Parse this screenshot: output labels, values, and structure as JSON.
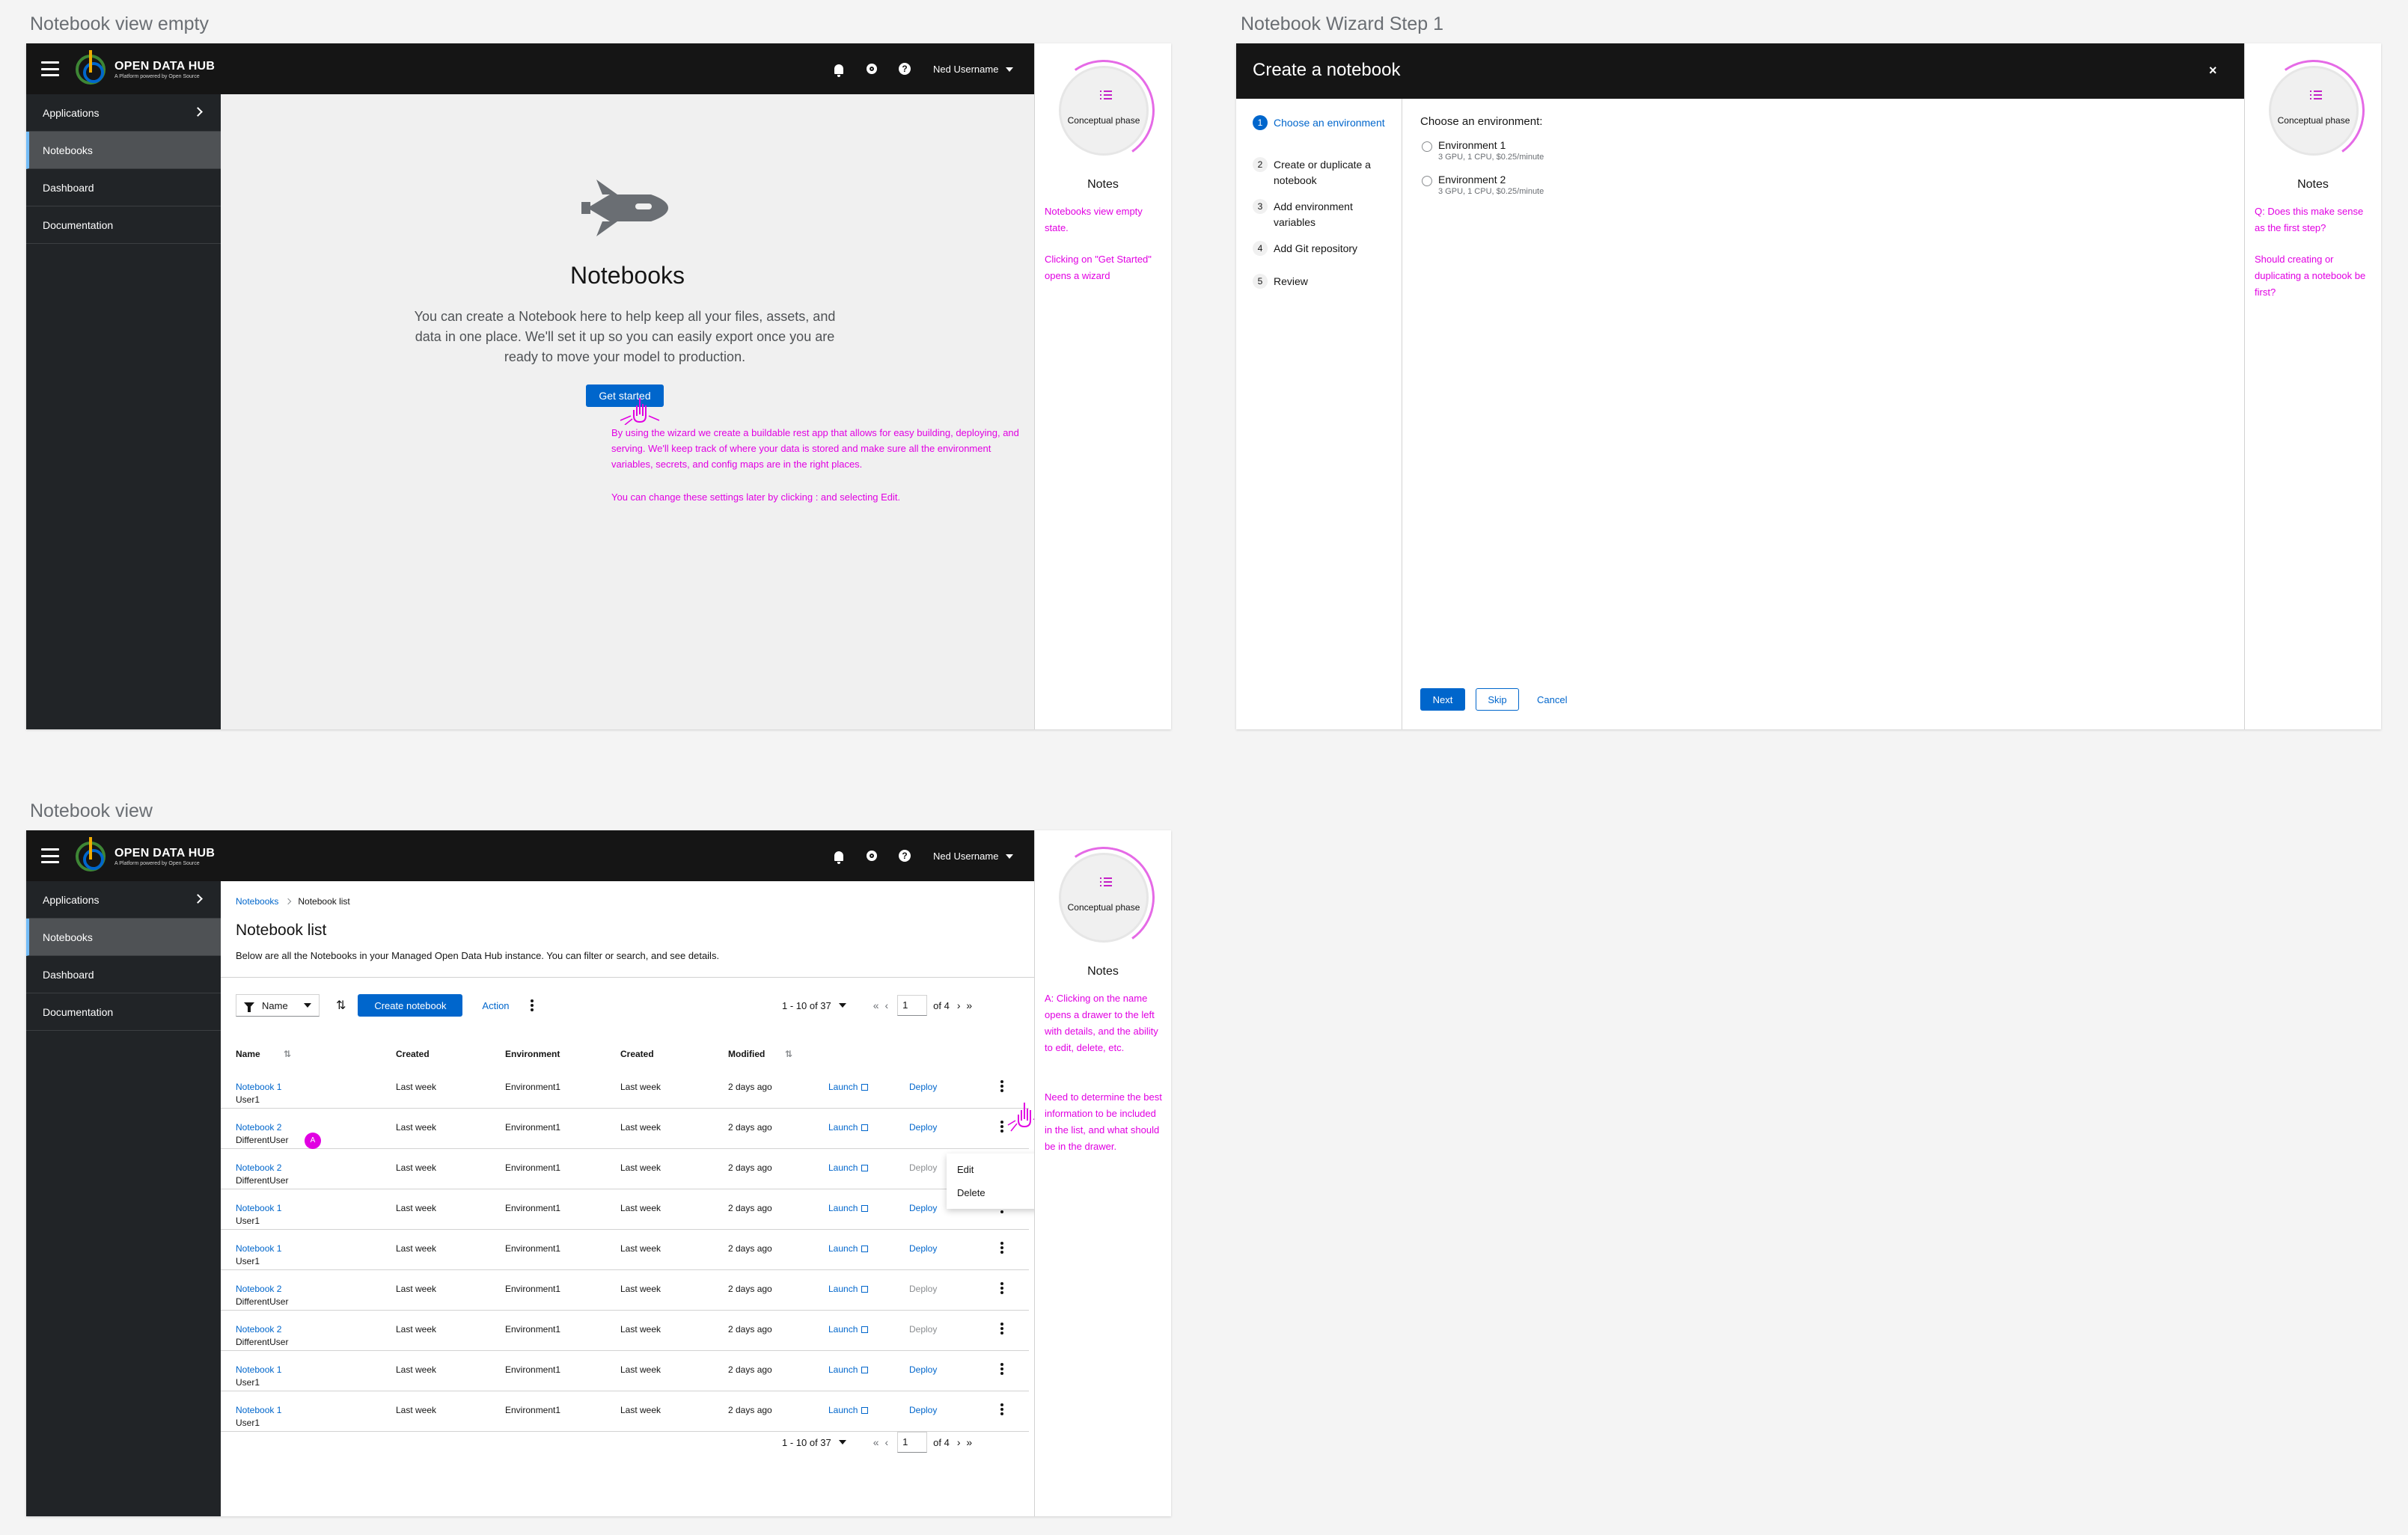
{
  "frames": {
    "empty_title": "Notebook view empty",
    "wizard_title": "Notebook Wizard Step 1",
    "list_title": "Notebook view"
  },
  "masthead": {
    "brand": "OPEN DATA HUB",
    "brand_sub": "A Platform powered by Open Source",
    "user": "Ned Username"
  },
  "sidebar": {
    "items": [
      "Applications",
      "Notebooks",
      "Dashboard",
      "Documentation"
    ]
  },
  "notes": {
    "phase": "Conceptual phase",
    "title": "Notes",
    "empty": [
      "Notebooks view empty state.",
      "Clicking on \"Get Started\" opens a wizard"
    ],
    "wizard": [
      "Q: Does this make sense as the first step?",
      "Should creating or duplicating a notebook be first?"
    ],
    "list": [
      "A: Clicking on the name opens a drawer to the left with details, and the ability to edit, delete, etc.",
      "Need to determine the best information to be included in the list, and what should be in the drawer."
    ]
  },
  "empty_state": {
    "title": "Notebooks",
    "body": "You can create a Notebook here to help keep all your files, assets, and data in one place. We'll set it up so you can easily export once you are ready to move your model to production.",
    "button": "Get started",
    "annotation1": "By using the wizard we create a buildable rest app that allows for easy building, deploying, and serving. We'll keep track of where your data is stored and make sure all the environment variables, secrets, and config maps are in the right places.",
    "annotation2": "You can change these settings later by clicking : and selecting Edit."
  },
  "wizard": {
    "title": "Create a notebook",
    "close": "×",
    "steps": [
      {
        "num": "1",
        "label": "Choose an environment"
      },
      {
        "num": "2",
        "label": "Create or duplicate a notebook"
      },
      {
        "num": "3",
        "label": "Add environment variables"
      },
      {
        "num": "4",
        "label": "Add Git repository"
      },
      {
        "num": "5",
        "label": "Review"
      }
    ],
    "prompt": "Choose an environment:",
    "options": [
      {
        "label": "Environment 1",
        "desc": "3 GPU, 1 CPU, $0.25/minute"
      },
      {
        "label": "Environment 2",
        "desc": "3 GPU, 1 CPU, $0.25/minute"
      }
    ],
    "next": "Next",
    "skip": "Skip",
    "cancel": "Cancel"
  },
  "list": {
    "breadcrumb": [
      "Notebooks",
      "Notebook list"
    ],
    "title": "Notebook list",
    "description": "Below are all the Notebooks in your Managed Open Data Hub instance. You can filter or search, and see details.",
    "filter": "Name",
    "create_button": "Create notebook",
    "action_button": "Action",
    "pagination": {
      "range": "1 - 10 of 37",
      "page": "1",
      "of": "of 4"
    },
    "columns": [
      "Name",
      "Created",
      "Environment",
      "Created",
      "Modified"
    ],
    "rows": [
      {
        "name": "Notebook 1",
        "user": "User1",
        "created": "Last week",
        "env": "Environment1",
        "created2": "Last week",
        "modified": "2 days ago",
        "launch": "Launch",
        "deploy": "Deploy",
        "deploy_enabled": true
      },
      {
        "name": "Notebook 2",
        "user": "DifferentUser",
        "created": "Last week",
        "env": "Environment1",
        "created2": "Last week",
        "modified": "2 days ago",
        "launch": "Launch",
        "deploy": "Deploy",
        "deploy_enabled": true
      },
      {
        "name": "Notebook 2",
        "user": "DifferentUser",
        "created": "Last week",
        "env": "Environment1",
        "created2": "Last week",
        "modified": "2 days ago",
        "launch": "Launch",
        "deploy": "Deploy",
        "deploy_enabled": false
      },
      {
        "name": "Notebook 1",
        "user": "User1",
        "created": "Last week",
        "env": "Environment1",
        "created2": "Last week",
        "modified": "2 days ago",
        "launch": "Launch",
        "deploy": "Deploy",
        "deploy_enabled": true
      },
      {
        "name": "Notebook 1",
        "user": "User1",
        "created": "Last week",
        "env": "Environment1",
        "created2": "Last week",
        "modified": "2 days ago",
        "launch": "Launch",
        "deploy": "Deploy",
        "deploy_enabled": true
      },
      {
        "name": "Notebook 2",
        "user": "DifferentUser",
        "created": "Last week",
        "env": "Environment1",
        "created2": "Last week",
        "modified": "2 days ago",
        "launch": "Launch",
        "deploy": "Deploy",
        "deploy_enabled": false
      },
      {
        "name": "Notebook 2",
        "user": "DifferentUser",
        "created": "Last week",
        "env": "Environment1",
        "created2": "Last week",
        "modified": "2 days ago",
        "launch": "Launch",
        "deploy": "Deploy",
        "deploy_enabled": false
      },
      {
        "name": "Notebook 1",
        "user": "User1",
        "created": "Last week",
        "env": "Environment1",
        "created2": "Last week",
        "modified": "2 days ago",
        "launch": "Launch",
        "deploy": "Deploy",
        "deploy_enabled": true
      },
      {
        "name": "Notebook 1",
        "user": "User1",
        "created": "Last week",
        "env": "Environment1",
        "created2": "Last week",
        "modified": "2 days ago",
        "launch": "Launch",
        "deploy": "Deploy",
        "deploy_enabled": true
      }
    ],
    "menu": [
      "Edit",
      "Delete"
    ],
    "badge": "A"
  },
  "colors": {
    "accent": "#0066cc",
    "annotation": "#e100e2",
    "masthead": "#151515",
    "sidebar": "#212427"
  }
}
